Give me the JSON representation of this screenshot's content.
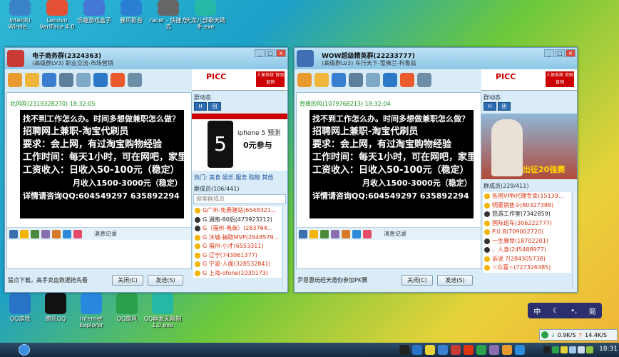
{
  "desktop_top": [
    {
      "label": "Intel(R) Wirele...",
      "color": "#3b83c9"
    },
    {
      "label": "Lenovo VeriFace 4.0",
      "color": "#e35033"
    },
    {
      "label": "乐趣游戏盒子",
      "color": "#4577d6"
    },
    {
      "label": "暴风影音",
      "color": "#2a7fd4"
    },
    {
      "label": "racer - 快捷方式",
      "color": "#666666"
    },
    {
      "label": "天龙八部聊天助手.exe",
      "color": "#25b8a6"
    }
  ],
  "desktop_bottom": [
    {
      "label": "QQ游戏",
      "color": "#2a74c8"
    },
    {
      "label": "腾讯QQ",
      "color": "#111111"
    },
    {
      "label": "Internet Explorer",
      "color": "#2888de"
    },
    {
      "label": "QQ旋风",
      "color": "#2aa14a"
    },
    {
      "label": "QQ群发无限制1.0.exe",
      "color": "#25b8a6"
    }
  ],
  "windows": [
    {
      "title": "电子商务群(2324363)",
      "subtitle": "(高级群LV3) 职业交流-市场营销",
      "sender": "北风吹(2318328270)  18:32:05",
      "ad_bar_text": "iphone 5 预测",
      "ad_sub": "0元参与",
      "side_tabs": "热门: 美食  娱乐  服务  购物  其他",
      "member_count": "群成员(106/441)",
      "search_placeholder": "搜索群成员",
      "members": [
        "G广州-免费建站(6548321...",
        "G 湖南-80后(473923212)",
        "G（福州-电商）(283764...",
        "G 沐城-抽取MVP(2848579...",
        "G 福州-小才(6553311)",
        "G 辽宁(743061377)",
        "G 宁波-人面(328532841)",
        "G 上海-ofone(1030173)"
      ],
      "tip": "猛点下载，高手卖血数据抢先看",
      "close_label": "关闭(C)",
      "send_label": "发送(S)"
    },
    {
      "title": "WOW超级精英群(22233777)",
      "subtitle": "(高级群LV3) 车行天下-雪佛兰-科鲁兹",
      "sender": "背叛的风(1079768213)  18:32:04",
      "ad_bar_text": "",
      "ad_sub": "出征20强赛",
      "side_tabs": "",
      "member_count": "群成员(229/411)",
      "search_placeholder": "",
      "members": [
        "各国VPN代理专卖(15139...",
        "明豪销售②(80327388)",
        "怒游工作室(7342859)",
        "国际班车(306222777)",
        "P.U.B(709002720)",
        "一生暴命(18702201)",
        "、人身(245488977)",
        "诉说 ?(284305738)",
        "☆众喜☆(727326385)"
      ],
      "tip": "尹恩惠玩经天邀你参加PK赛",
      "close_label": "关闭(C)",
      "send_label": "发送(S)"
    }
  ],
  "ad_lines": [
    "找不到工作怎么办。时间多想做兼职怎么做？",
    "招聘网上兼职-淘宝代刷员",
    "要求：会上网，有过淘宝购物经验",
    "工作时间：每天1小时，可在网吧，家里",
    "工资收入：日收入50-100元（稳定）",
    "月收入1500-3000元（稳定）",
    "详情请咨询QQ:604549297  635892294"
  ],
  "panel_labels": {
    "group_news": "群动态",
    "msg_record": "消息记录",
    "pad_logo": "PICC",
    "pad_badge": "人保系统 官网直销"
  },
  "ime": {
    "lang": "中",
    "mode": "简"
  },
  "netmon": {
    "down": "0.9K/S",
    "up": "14.4K/S"
  },
  "clock": "18:31"
}
